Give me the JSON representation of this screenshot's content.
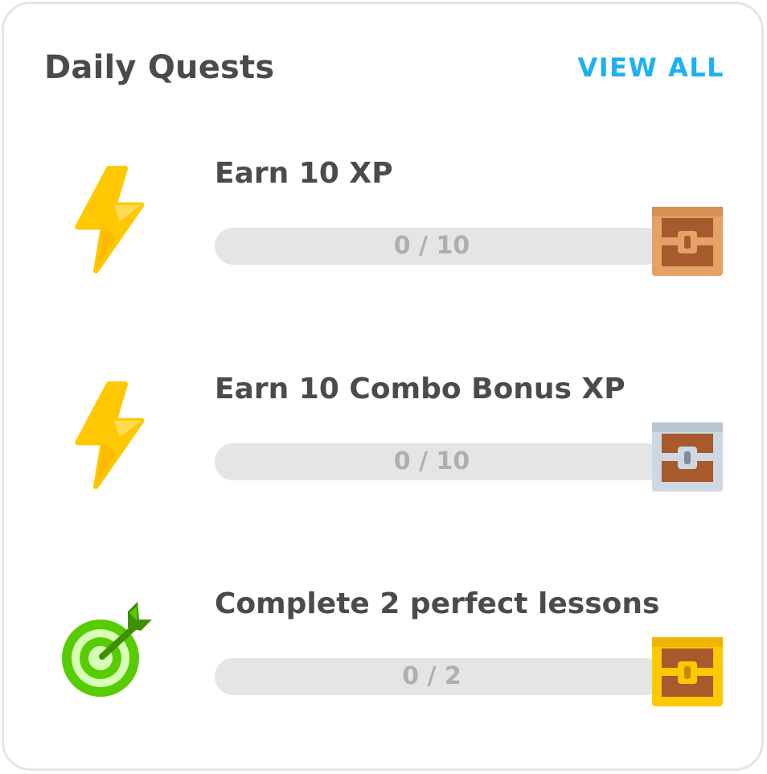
{
  "card": {
    "title": "Daily Quests",
    "view_all_label": "VIEW ALL"
  },
  "colors": {
    "accent": "#1cb0f6",
    "title_text": "#4b4b4b",
    "progress_track": "#e5e5e5",
    "progress_text": "#afafaf",
    "lightning": "#ffc800",
    "target_green": "#58cc02"
  },
  "quests": [
    {
      "icon": "lightning-bolt-icon",
      "title": "Earn 10 XP",
      "progress_label": "0 / 10",
      "progress_current": 0,
      "progress_goal": 10,
      "reward": "bronze-chest-icon"
    },
    {
      "icon": "lightning-bolt-icon",
      "title": "Earn 10 Combo Bonus XP",
      "progress_label": "0 / 10",
      "progress_current": 0,
      "progress_goal": 10,
      "reward": "silver-chest-icon"
    },
    {
      "icon": "target-icon",
      "title": "Complete 2 perfect lessons",
      "progress_label": "0 / 2",
      "progress_current": 0,
      "progress_goal": 2,
      "reward": "gold-chest-icon"
    }
  ]
}
